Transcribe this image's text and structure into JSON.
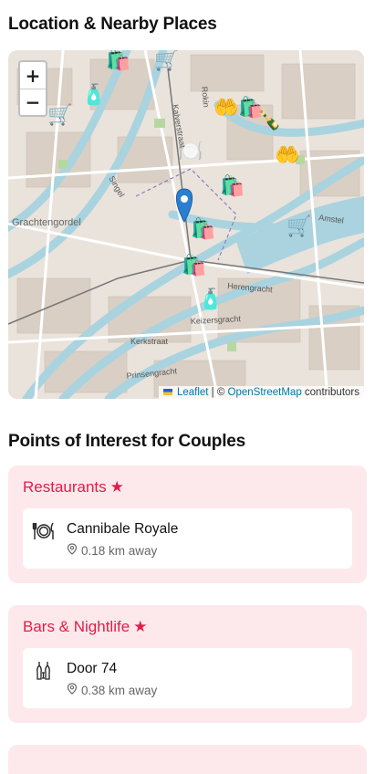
{
  "location": {
    "title": "Location & Nearby Places",
    "map": {
      "zoom_in": "+",
      "zoom_out": "−",
      "labels": {
        "grachtengordel": "Grachtengordel",
        "amstel": "Amstel",
        "herengracht": "Herengracht",
        "keizersgracht": "Keizersgracht",
        "prinsengracht": "Prinsengracht",
        "kerkstraat": "Kerkstraat",
        "singel": "Singel",
        "kalverstraat": "Kalverstraat",
        "rokin": "Rokin"
      },
      "attribution": {
        "leaflet": "Leaflet",
        "separator": " | © ",
        "osm": "OpenStreetMap",
        "contributors": " contributors"
      }
    }
  },
  "poi": {
    "title": "Points of Interest for Couples",
    "categories": [
      {
        "name": "Restaurants",
        "icon": "fork-knife-plate-icon",
        "places": [
          {
            "name": "Cannibale Royale",
            "distance": "0.18 km away"
          }
        ]
      },
      {
        "name": "Bars & Nightlife",
        "icon": "bottles-glass-icon",
        "places": [
          {
            "name": "Door 74",
            "distance": "0.38 km away"
          }
        ]
      }
    ]
  }
}
